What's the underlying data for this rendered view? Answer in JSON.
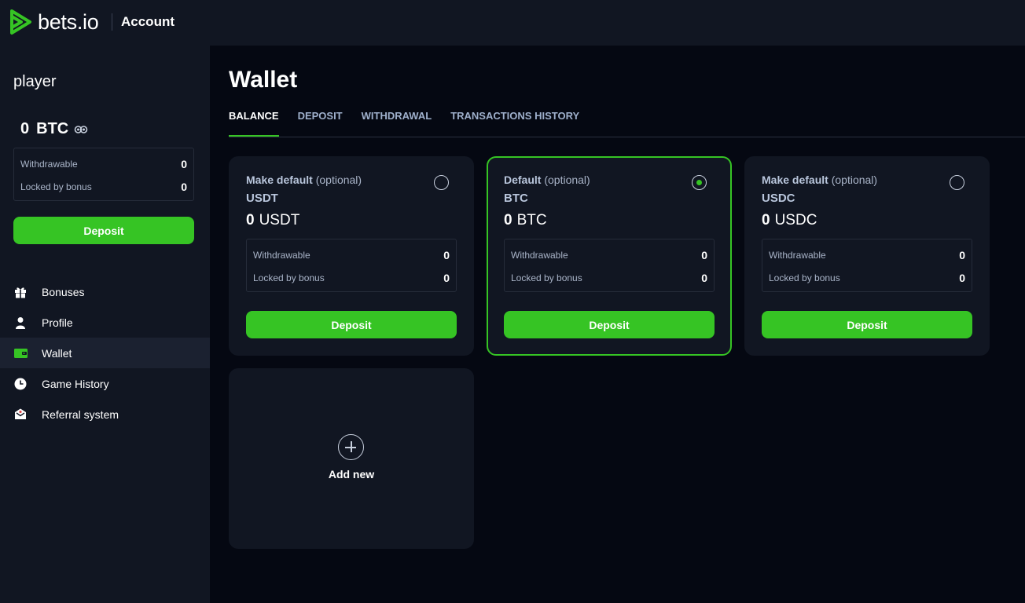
{
  "header": {
    "logo_text": "bets.io",
    "title": "Account",
    "brand_color": "#36c424"
  },
  "sidebar": {
    "username": "player",
    "balance": {
      "amount": "0",
      "currency": "BTC"
    },
    "withdrawable_label": "Withdrawable",
    "withdrawable_value": "0",
    "locked_label": "Locked by bonus",
    "locked_value": "0",
    "deposit_label": "Deposit",
    "nav": [
      {
        "label": "Bonuses",
        "icon": "gift-icon"
      },
      {
        "label": "Profile",
        "icon": "user-icon"
      },
      {
        "label": "Wallet",
        "icon": "wallet-icon",
        "active": true
      },
      {
        "label": "Game History",
        "icon": "clock-icon"
      },
      {
        "label": "Referral system",
        "icon": "envelope-icon"
      }
    ]
  },
  "main": {
    "title": "Wallet",
    "tabs": [
      {
        "label": "BALANCE",
        "active": true
      },
      {
        "label": "DEPOSIT"
      },
      {
        "label": "WITHDRAWAL"
      },
      {
        "label": "TRANSACTIONS HISTORY"
      }
    ],
    "cards": [
      {
        "head_strong": "Make default",
        "head_optional": "(optional)",
        "currency": "USDT",
        "amount": "0",
        "withdrawable_label": "Withdrawable",
        "withdrawable_value": "0",
        "locked_label": "Locked by bonus",
        "locked_value": "0",
        "deposit_label": "Deposit",
        "selected": false
      },
      {
        "head_strong": "Default",
        "head_optional": "(optional)",
        "currency": "BTC",
        "amount": "0",
        "withdrawable_label": "Withdrawable",
        "withdrawable_value": "0",
        "locked_label": "Locked by bonus",
        "locked_value": "0",
        "deposit_label": "Deposit",
        "selected": true
      },
      {
        "head_strong": "Make default",
        "head_optional": "(optional)",
        "currency": "USDC",
        "amount": "0",
        "withdrawable_label": "Withdrawable",
        "withdrawable_value": "0",
        "locked_label": "Locked by bonus",
        "locked_value": "0",
        "deposit_label": "Deposit",
        "selected": false
      }
    ],
    "add_new_label": "Add new"
  }
}
